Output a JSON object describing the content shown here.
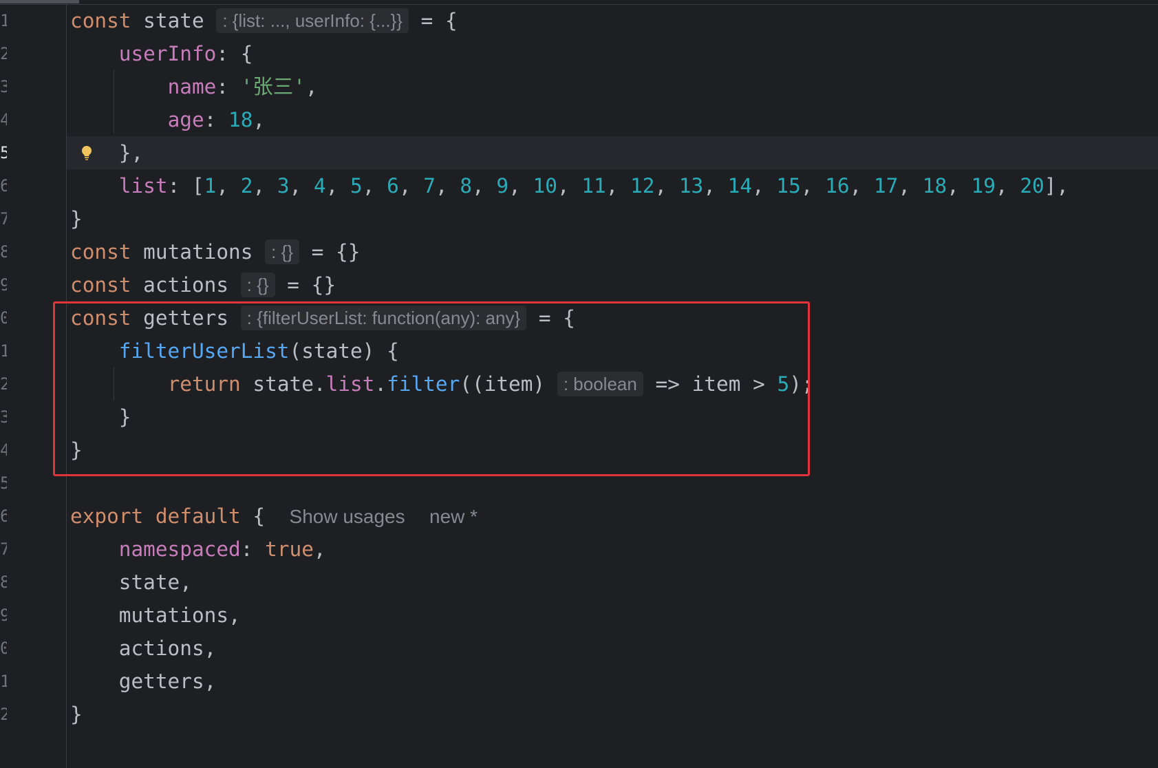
{
  "editor": {
    "line_numbers": [
      "1",
      "2",
      "3",
      "4",
      "5",
      "6",
      "7",
      "8",
      "9",
      "0",
      "1",
      "2",
      "3",
      "4",
      "5",
      "6",
      "7",
      "8",
      "9",
      "0",
      "1",
      "2"
    ],
    "lines": {
      "l1": {
        "kw": "const",
        "name": " state",
        "hint": ": {list: ..., userInfo: {...}}",
        "rest": " = {"
      },
      "l2": {
        "prop": "userInfo",
        "rest": ": {"
      },
      "l3": {
        "prop": "name",
        "sep": ": ",
        "str": "'张三'",
        "rest": ","
      },
      "l4": {
        "prop": "age",
        "sep": ": ",
        "num": "18",
        "rest": ","
      },
      "l5": {
        "rest": "},"
      },
      "l6": {
        "prop": "list",
        "open": ": [",
        "items": [
          "1",
          "2",
          "3",
          "4",
          "5",
          "6",
          "7",
          "8",
          "9",
          "10",
          "11",
          "12",
          "13",
          "14",
          "15",
          "16",
          "17",
          "18",
          "19",
          "20"
        ],
        "close": "],"
      },
      "l7": {
        "rest": "}"
      },
      "l8": {
        "kw": "const",
        "name": " mutations",
        "hint": ": {}",
        "rest": " = {}"
      },
      "l9": {
        "kw": "const",
        "name": " actions",
        "hint": ": {}",
        "rest": " = {}"
      },
      "l10": {
        "kw": "const",
        "name": " getters",
        "hint": ": {filterUserList: function(any): any}",
        "rest": " = {"
      },
      "l11": {
        "fn": "filterUserList",
        "rest": "(state) {"
      },
      "l12": {
        "kw": "return",
        "mid1": " state.",
        "prop": "list",
        "dot": ".",
        "fn": "filter",
        "mid2": "((item)",
        "hint": ": boolean",
        "mid3": " => item > ",
        "num": "5",
        "end": ");"
      },
      "l13": {
        "rest": "}"
      },
      "l14": {
        "rest": "}"
      },
      "l16": {
        "kw": "export default",
        "rest": " {",
        "lens1": "Show usages",
        "lens2": "new *"
      },
      "l17": {
        "prop": "namespaced",
        "sep": ": ",
        "kw": "true",
        "rest": ","
      },
      "l18": {
        "rest": "state,"
      },
      "l19": {
        "rest": "mutations,"
      },
      "l20": {
        "rest": "actions,"
      },
      "l21": {
        "rest": "getters,"
      },
      "l22": {
        "rest": "}"
      }
    }
  }
}
